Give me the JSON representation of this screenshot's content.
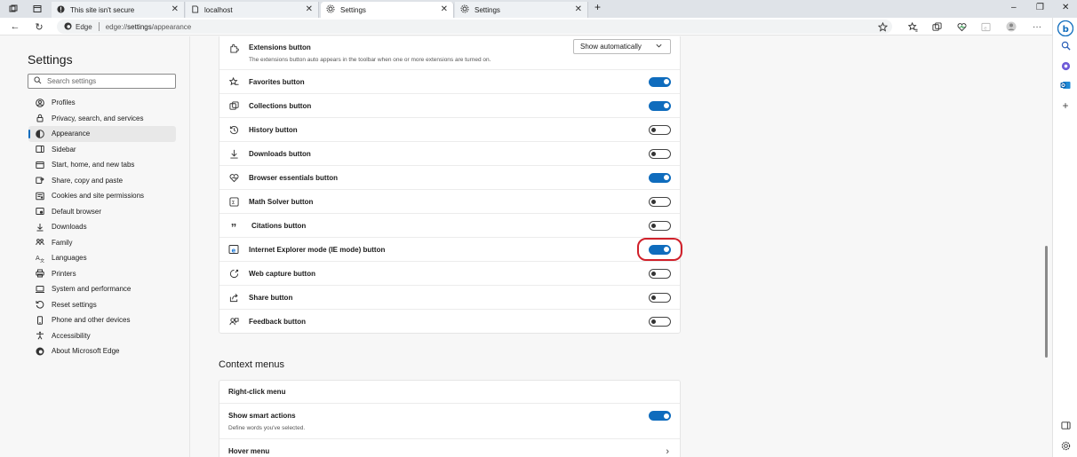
{
  "tabs": [
    {
      "title": "This site isn't secure",
      "active": false
    },
    {
      "title": "localhost",
      "active": false
    },
    {
      "title": "Settings",
      "active": true
    },
    {
      "title": "Settings",
      "active": false
    }
  ],
  "window": {
    "new_tab": "+",
    "minimize": "–",
    "restore": "❐",
    "close": "✕"
  },
  "addressbar": {
    "edge_label": "Edge",
    "url_prefix": "edge://",
    "url_bold": "settings",
    "url_suffix": "/appearance"
  },
  "settings": {
    "title": "Settings",
    "search_placeholder": "Search settings",
    "nav": [
      {
        "label": "Profiles",
        "icon": "profile-icon"
      },
      {
        "label": "Privacy, search, and services",
        "icon": "lock-icon"
      },
      {
        "label": "Appearance",
        "icon": "appearance-icon",
        "active": true
      },
      {
        "label": "Sidebar",
        "icon": "sidebar-icon"
      },
      {
        "label": "Start, home, and new tabs",
        "icon": "home-tabs-icon"
      },
      {
        "label": "Share, copy and paste",
        "icon": "share-copy-icon"
      },
      {
        "label": "Cookies and site permissions",
        "icon": "cookies-icon"
      },
      {
        "label": "Default browser",
        "icon": "default-browser-icon"
      },
      {
        "label": "Downloads",
        "icon": "download-icon"
      },
      {
        "label": "Family",
        "icon": "family-icon"
      },
      {
        "label": "Languages",
        "icon": "languages-icon"
      },
      {
        "label": "Printers",
        "icon": "printer-icon"
      },
      {
        "label": "System and performance",
        "icon": "system-icon"
      },
      {
        "label": "Reset settings",
        "icon": "reset-icon"
      },
      {
        "label": "Phone and other devices",
        "icon": "phone-icon"
      },
      {
        "label": "Accessibility",
        "icon": "accessibility-icon"
      },
      {
        "label": "About Microsoft Edge",
        "icon": "edge-logo-icon"
      }
    ]
  },
  "toolbar_buttons": {
    "extensions": {
      "label": "Extensions button",
      "description": "The extensions button auto appears in the toolbar when one or more extensions are turned on.",
      "dropdown_value": "Show automatically"
    },
    "items": [
      {
        "label": "Favorites button",
        "on": true,
        "icon": "favorites-icon"
      },
      {
        "label": "Collections button",
        "on": true,
        "icon": "collections-icon"
      },
      {
        "label": "History button",
        "on": false,
        "icon": "history-icon"
      },
      {
        "label": "Downloads button",
        "on": false,
        "icon": "download-icon"
      },
      {
        "label": "Browser essentials button",
        "on": true,
        "icon": "heart-pulse-icon"
      },
      {
        "label": "Math Solver button",
        "on": false,
        "icon": "math-solver-icon"
      },
      {
        "label": "Citations button",
        "on": false,
        "icon": "quote-icon"
      },
      {
        "label": "Internet Explorer mode (IE mode) button",
        "on": true,
        "icon": "ie-mode-icon",
        "highlighted": true
      },
      {
        "label": "Web capture button",
        "on": false,
        "icon": "web-capture-icon"
      },
      {
        "label": "Share button",
        "on": false,
        "icon": "share-icon"
      },
      {
        "label": "Feedback button",
        "on": false,
        "icon": "feedback-icon"
      }
    ]
  },
  "context_menus": {
    "title": "Context menus",
    "right_click_menu": "Right-click menu",
    "smart_actions": {
      "label": "Show smart actions",
      "description": "Define words you've selected.",
      "on": true
    },
    "hover_menu": "Hover menu"
  },
  "colors": {
    "accent": "#0f6cbd",
    "highlight_ring": "#d0202a"
  }
}
